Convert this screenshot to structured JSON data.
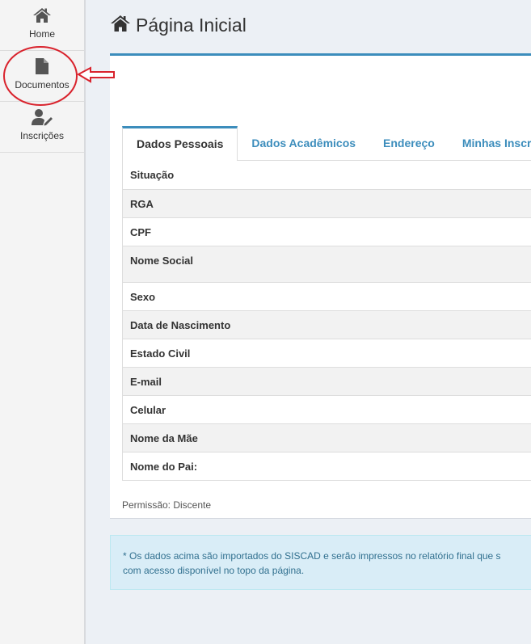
{
  "sidebar": {
    "items": [
      {
        "label": "Home",
        "icon": "home-icon"
      },
      {
        "label": "Documentos",
        "icon": "file-icon"
      },
      {
        "label": "Inscrições",
        "icon": "user-edit-icon"
      }
    ]
  },
  "header": {
    "title": "Página Inicial",
    "icon": "home-icon"
  },
  "tabs": [
    {
      "label": "Dados Pessoais",
      "active": true
    },
    {
      "label": "Dados Acadêmicos"
    },
    {
      "label": "Endereço"
    },
    {
      "label": "Minhas Inscri"
    }
  ],
  "fields": [
    "Situação",
    "RGA",
    "CPF",
    "Nome Social",
    "Sexo",
    "Data de Nascimento",
    "Estado Civil",
    "E-mail",
    "Celular",
    "Nome da Mãe",
    "Nome do Pai:"
  ],
  "permission": "Permissão: Discente",
  "notice": {
    "line1": "* Os dados acima são importados do SISCAD e serão impressos no relatório final que s",
    "line2": "com acesso disponível no topo da página."
  },
  "colors": {
    "accent": "#3c8dbc",
    "annotation": "#d9232d",
    "notice_bg": "#d9edf7"
  }
}
